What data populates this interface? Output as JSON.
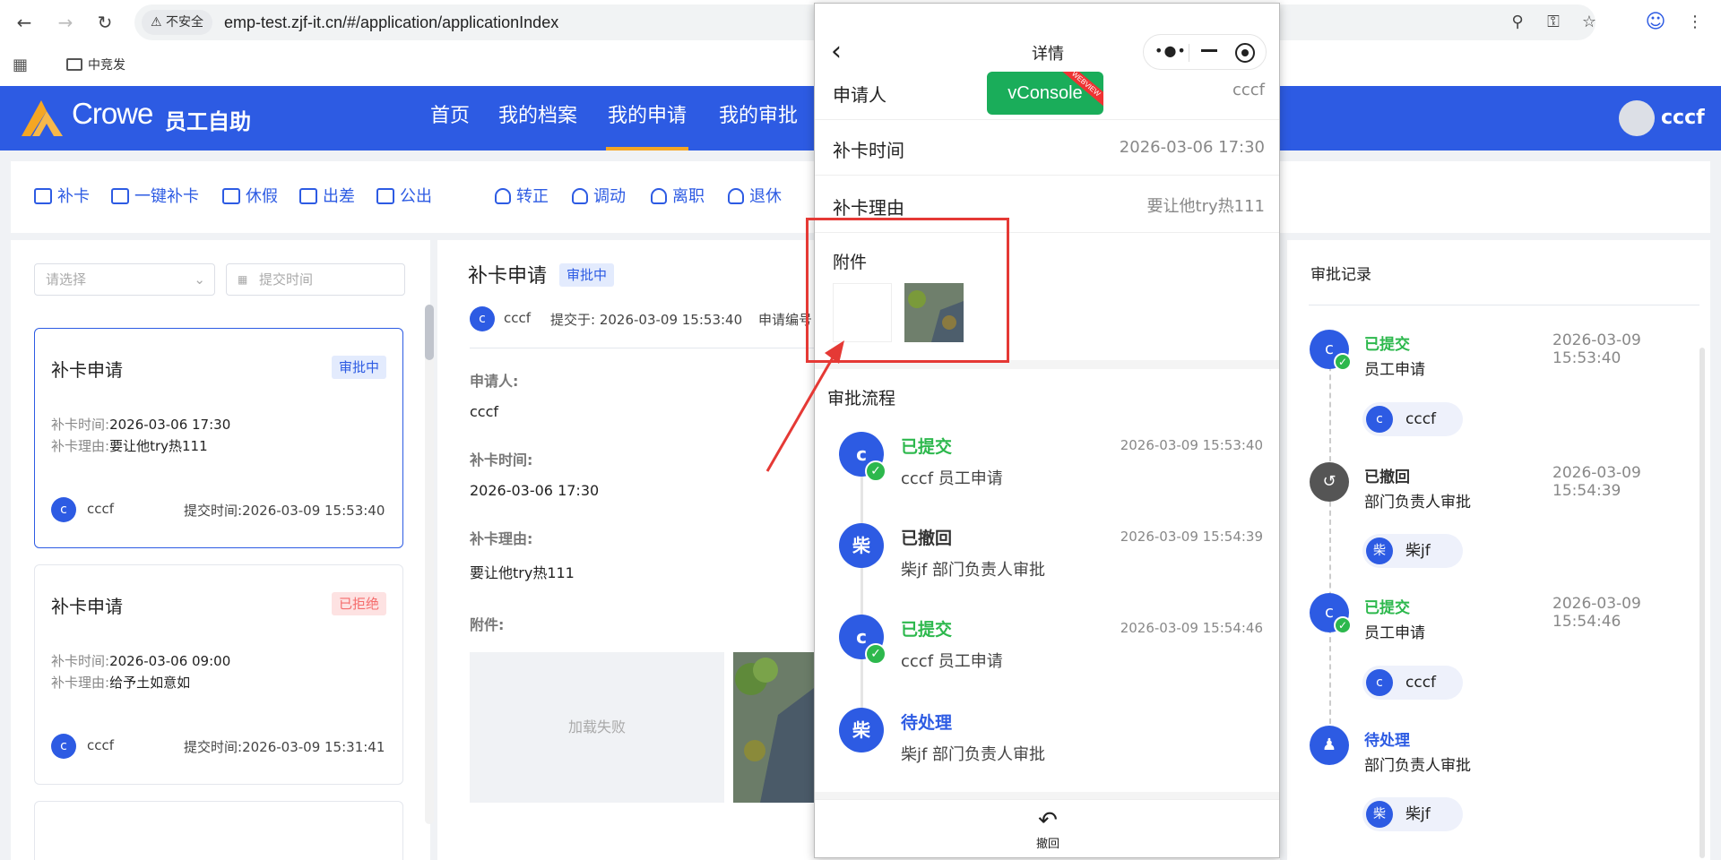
{
  "browser": {
    "insecure_label": "不安全",
    "url": "emp-test.zjf-it.cn/#/application/applicationIndex",
    "bookmark_folder": "中竞发"
  },
  "app": {
    "brand": "Crowe",
    "brand_sub": "员工自助",
    "nav": [
      "首页",
      "我的档案",
      "我的申请",
      "我的审批"
    ],
    "active_nav": "我的申请",
    "username": "cccf",
    "brand_color": "#2d5be3"
  },
  "types": [
    "补卡",
    "一键补卡",
    "休假",
    "出差",
    "公出",
    "转正",
    "调动",
    "离职",
    "退休"
  ],
  "filters": {
    "select_placeholder": "请选择",
    "date_placeholder": "提交时间"
  },
  "cards": [
    {
      "title": "补卡申请",
      "status": "审批中",
      "time_label": "补卡时间:",
      "time": "2026-03-06 17:30",
      "reason_label": "补卡理由:",
      "reason": "要让他try热111",
      "avatar": "c",
      "user": "cccf",
      "submit_label": "提交时间:",
      "submit_time": "2026-03-09 15:53:40"
    },
    {
      "title": "补卡申请",
      "status": "已拒绝",
      "time_label": "补卡时间:",
      "time": "2026-03-06 09:00",
      "reason_label": "补卡理由:",
      "reason": "给予土如意如",
      "avatar": "c",
      "user": "cccf",
      "submit_label": "提交时间:",
      "submit_time": "2026-03-09 15:31:41"
    }
  ],
  "detail": {
    "title": "补卡申请",
    "status": "审批中",
    "avatar": "c",
    "user": "cccf",
    "submitted": "提交于: 2026-03-09 15:53:40",
    "number_label": "申请编号",
    "applicant_label": "申请人:",
    "applicant": "cccf",
    "time_label": "补卡时间:",
    "time": "2026-03-06 17:30",
    "reason_label": "补卡理由:",
    "reason": "要让他try热111",
    "attach_label": "附件:",
    "load_failed": "加载失败"
  },
  "records": {
    "title": "审批记录",
    "items": [
      {
        "status": "已提交",
        "sub": "员工申请",
        "time": "2026-03-09 15:53:40",
        "avatar": "c",
        "user": "cccf",
        "color": "#2db84d"
      },
      {
        "status": "已撤回",
        "sub": "部门负责人审批",
        "time": "2026-03-09 15:54:39",
        "avatar": "柴",
        "user": "柴jf",
        "color": "#555555"
      },
      {
        "status": "已提交",
        "sub": "员工申请",
        "time": "2026-03-09 15:54:46",
        "avatar": "c",
        "user": "cccf",
        "color": "#2db84d"
      },
      {
        "status": "待处理",
        "sub": "部门负责人审批",
        "time": "",
        "avatar": "柴",
        "user": "柴jf",
        "color": "#2d5be3"
      }
    ]
  },
  "phone": {
    "title": "详情",
    "vconsole": "vConsole",
    "webview_tag": "WEBVIEW",
    "rows": [
      {
        "label": "申请人",
        "value": "cccf"
      },
      {
        "label": "补卡时间",
        "value": "2026-03-06 17:30"
      },
      {
        "label": "补卡理由",
        "value": "要让他try热111"
      }
    ],
    "attach_label": "附件",
    "flow_title": "审批流程",
    "flow": [
      {
        "avatar": "c",
        "status": "已提交",
        "sub": "cccf 员工申请",
        "time": "2026-03-09 15:53:40",
        "color": "#2db84d"
      },
      {
        "avatar": "柴",
        "status": "已撤回",
        "sub": "柴jf 部门负责人审批",
        "time": "2026-03-09 15:54:39",
        "color": "#333333"
      },
      {
        "avatar": "c",
        "status": "已提交",
        "sub": "cccf 员工申请",
        "time": "2026-03-09 15:54:46",
        "color": "#2db84d"
      },
      {
        "avatar": "柴",
        "status": "待处理",
        "sub": "柴jf 部门负责人审批",
        "time": "",
        "color": "#2d5be3"
      }
    ],
    "revoke_label": "撤回"
  }
}
